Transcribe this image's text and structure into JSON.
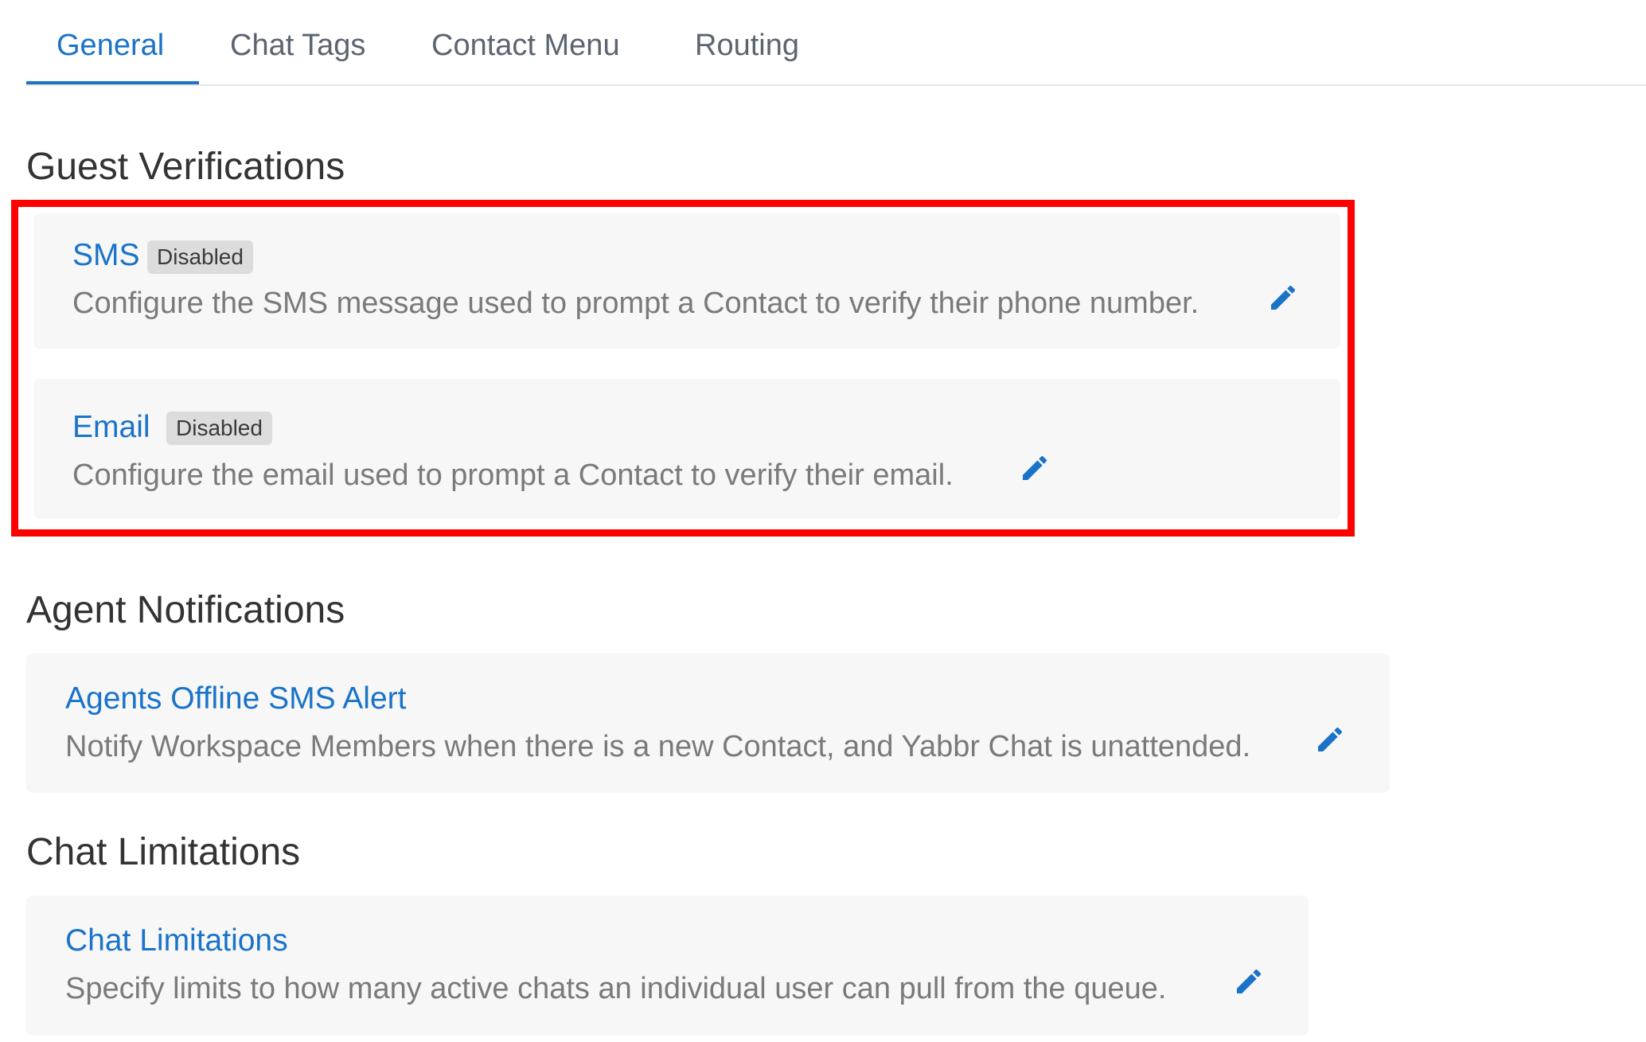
{
  "tabs": [
    {
      "label": "General",
      "active": true
    },
    {
      "label": "Chat Tags",
      "active": false
    },
    {
      "label": "Contact Menu",
      "active": false
    },
    {
      "label": "Routing",
      "active": false
    }
  ],
  "sections": {
    "guest_verifications": {
      "title": "Guest Verifications",
      "items": [
        {
          "title": "SMS",
          "badge": "Disabled",
          "description": "Configure the SMS message used to prompt a Contact to verify their phone number."
        },
        {
          "title": "Email",
          "badge": "Disabled",
          "description": "Configure the email used to prompt a Contact to verify their email."
        }
      ]
    },
    "agent_notifications": {
      "title": "Agent Notifications",
      "items": [
        {
          "title": "Agents Offline SMS Alert",
          "description": "Notify Workspace Members when there is a new Contact, and Yabbr Chat is unattended."
        }
      ]
    },
    "chat_limitations": {
      "title": "Chat Limitations",
      "items": [
        {
          "title": "Chat Limitations",
          "description": "Specify limits to how many active chats an individual user can pull from the queue."
        }
      ]
    }
  },
  "icons": {
    "edit": "pencil-icon"
  },
  "colors": {
    "accent": "#1a73c8",
    "highlight": "#ff0000",
    "card_bg": "#f7f7f7",
    "badge_bg": "#dcdcdc"
  }
}
